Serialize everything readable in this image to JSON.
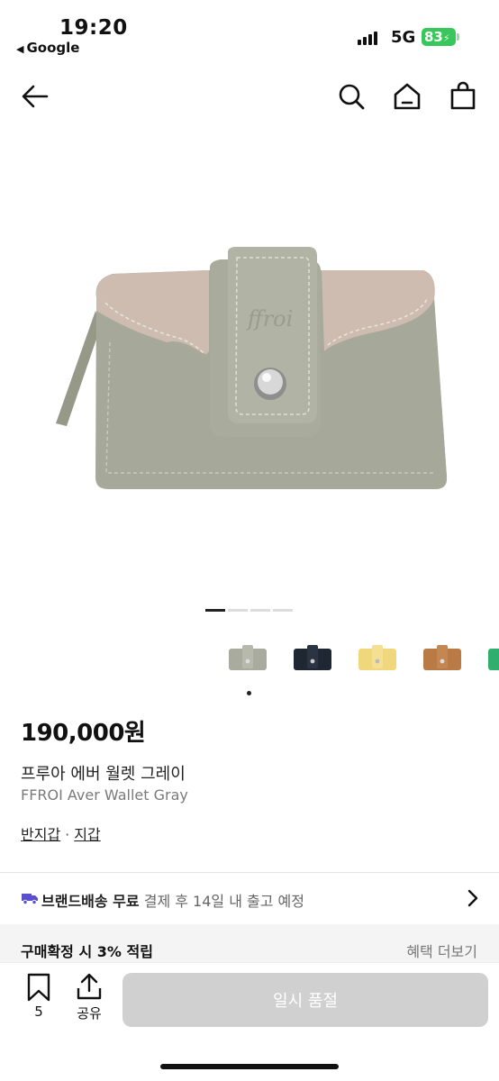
{
  "status_bar": {
    "time": "19:20",
    "back_app": "Google",
    "network": "5G",
    "battery": "83"
  },
  "nav": {
    "back_icon": "arrow-left-icon",
    "search_icon": "search-icon",
    "home_icon": "home-icon",
    "bag_icon": "shopping-bag-icon"
  },
  "product": {
    "image_logo": "ffroi",
    "image_count": 4,
    "active_image": 1,
    "colors": [
      {
        "name": "gray",
        "hex": "#a9ab9e"
      },
      {
        "name": "navy",
        "hex": "#1f2733"
      },
      {
        "name": "yellow",
        "hex": "#f1d77b"
      },
      {
        "name": "brown",
        "hex": "#b97a45"
      },
      {
        "name": "green",
        "hex": "#2fae6e"
      }
    ],
    "price": "190,000원",
    "name_ko": "프루아 에버 월렛 그레이",
    "name_en": "FFROI Aver Wallet Gray",
    "categories": [
      "반지갑",
      "지갑"
    ],
    "category_separator": "·"
  },
  "shipping": {
    "label": "브랜드배송 무료",
    "detail": "결제 후 14일 내 출고 예정"
  },
  "benefit": {
    "label": "구매확정 시 3% 적립",
    "link": "혜택 더보기"
  },
  "bottom_bar": {
    "bookmark_count": "5",
    "share_label": "공유",
    "cta_label": "일시 품절"
  },
  "colors": {
    "wallet": "#a9ab9e",
    "disabled_button": "#d0d0d0",
    "shipping_icon": "#5a4fcf"
  }
}
